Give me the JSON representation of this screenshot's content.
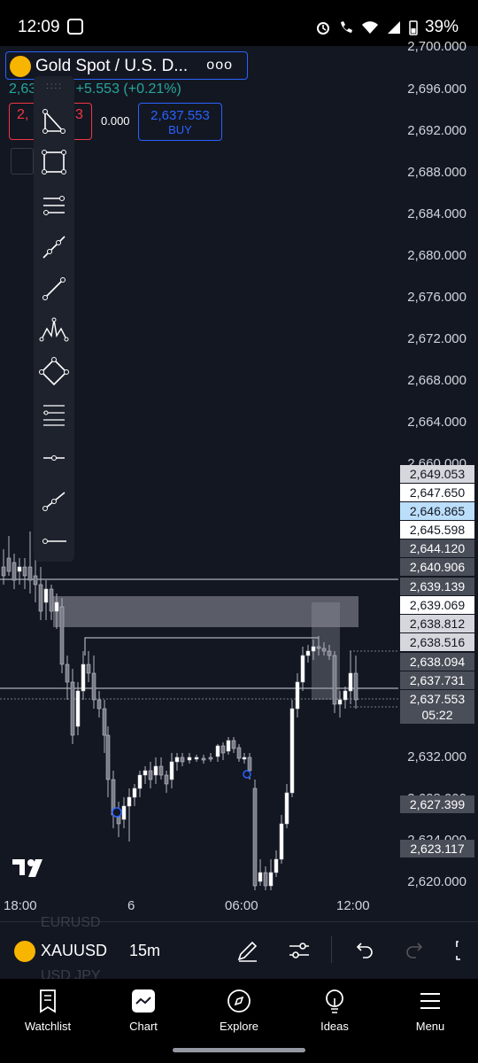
{
  "status": {
    "time": "12:09",
    "battery": "39%"
  },
  "header": {
    "title": "Gold Spot / U.S. D...",
    "more": "ooo",
    "price_prefix": "2,63",
    "change": "+5.553 (+0.21%)",
    "sell_price": "2,",
    "sell_price_tail": "3",
    "spread": "0.000",
    "buy_price": "2,637.553",
    "buy_label": "BUY"
  },
  "price_axis": [
    "2,700.000",
    "2,696.000",
    "2,692.000",
    "2,688.000",
    "2,684.000",
    "2,680.000",
    "2,676.000",
    "2,672.000",
    "2,668.000",
    "2,664.000",
    "2,660.000",
    "2,632.000",
    "2,628.000",
    "2,624.000",
    "2,620.000"
  ],
  "price_tags": [
    "2,649.053",
    "2,647.650",
    "2,646.865",
    "2,645.598",
    "2,644.120",
    "2,640.906",
    "2,639.139",
    "2,639.069",
    "2,638.812",
    "2,638.516",
    "2,638.094",
    "2,637.731",
    "2,637.553",
    "05:22",
    "2,627.399",
    "2,623.117"
  ],
  "time_axis": [
    "18:00",
    "6",
    "06:00",
    "12:00"
  ],
  "bottom_toolbar": {
    "ghost_top": "EURUSD",
    "ghost_bottom": "USD JPY",
    "symbol": "XAUUSD",
    "interval": "15m"
  },
  "nav": [
    "Watchlist",
    "Chart",
    "Explore",
    "Ideas",
    "Menu"
  ],
  "colors": {
    "background": "#131722",
    "up": "#26a69a",
    "down": "#f23645",
    "accent": "#2962ff",
    "gold": "#f7b500"
  }
}
